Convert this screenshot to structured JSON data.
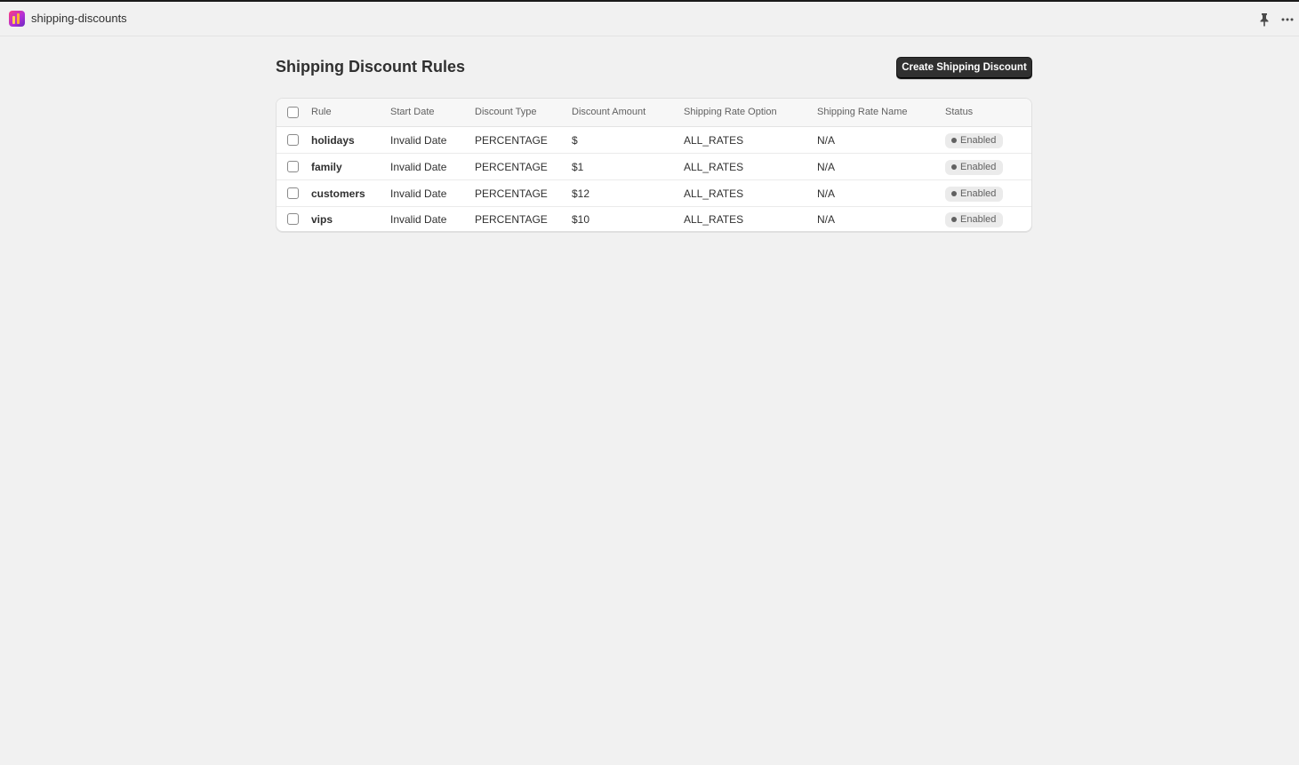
{
  "app": {
    "name": "shipping-discounts"
  },
  "page": {
    "title": "Shipping Discount Rules",
    "create_button_label": "Create Shipping Discount"
  },
  "table": {
    "columns": [
      "Rule",
      "Start Date",
      "Discount Type",
      "Discount Amount",
      "Shipping Rate Option",
      "Shipping Rate Name",
      "Status"
    ],
    "rows": [
      {
        "rule": "holidays",
        "start_date": "Invalid Date",
        "discount_type": "PERCENTAGE",
        "discount_amount": "$",
        "rate_option": "ALL_RATES",
        "rate_name": "N/A",
        "status": "Enabled"
      },
      {
        "rule": "family",
        "start_date": "Invalid Date",
        "discount_type": "PERCENTAGE",
        "discount_amount": "$1",
        "rate_option": "ALL_RATES",
        "rate_name": "N/A",
        "status": "Enabled"
      },
      {
        "rule": "customers",
        "start_date": "Invalid Date",
        "discount_type": "PERCENTAGE",
        "discount_amount": "$12",
        "rate_option": "ALL_RATES",
        "rate_name": "N/A",
        "status": "Enabled"
      },
      {
        "rule": "vips",
        "start_date": "Invalid Date",
        "discount_type": "PERCENTAGE",
        "discount_amount": "$10",
        "rate_option": "ALL_RATES",
        "rate_name": "N/A",
        "status": "Enabled"
      }
    ]
  },
  "icons": {
    "app": "app-logo-icon",
    "pin": "pin-icon",
    "more": "more-horizontal-icon"
  },
  "colors": {
    "primary_button": "#303030",
    "background": "#f1f1f1",
    "badge": "#ebebeb"
  }
}
